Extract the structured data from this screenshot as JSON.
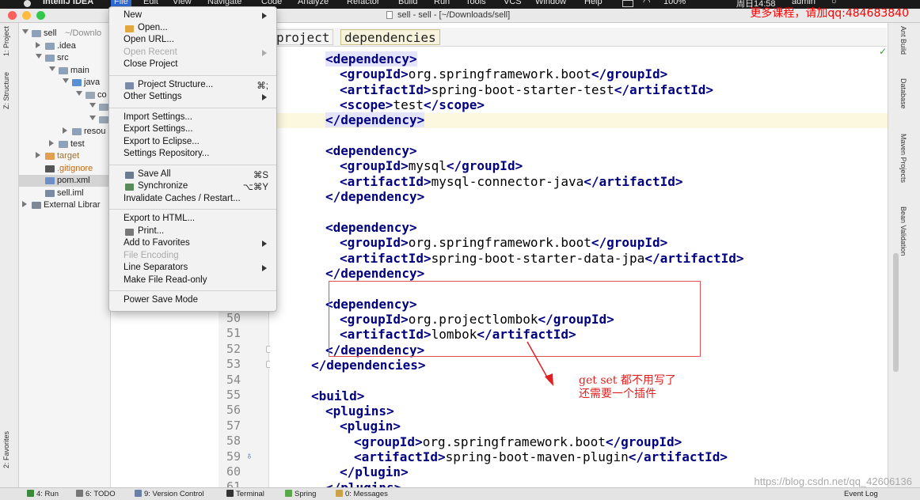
{
  "menubar": {
    "app_name": "IntelliJ IDEA",
    "items": [
      "File",
      "Edit",
      "View",
      "Navigate",
      "Code",
      "Analyze",
      "Refactor",
      "Build",
      "Run",
      "Tools",
      "VCS",
      "Window",
      "Help"
    ],
    "battery": "100%",
    "clock": "周日14:58",
    "user": "admin"
  },
  "titlebar": {
    "title": "sell - sell - [~/Downloads/sell]",
    "promo": "更多课程，请加qq:484683840",
    "traffic_colors": [
      "#fc605c",
      "#fdbc40",
      "#34c84a"
    ]
  },
  "left_strip": {
    "tabs": [
      "1: Project",
      "Z: Structure",
      "2: Favorites"
    ]
  },
  "project_tree": {
    "rows": [
      {
        "label": "sell",
        "suffix": "~/Downlo",
        "arrow": "down",
        "icon": "folder-icon"
      },
      {
        "label": ".idea",
        "arrow": "right",
        "icon": "folder-icon"
      },
      {
        "label": "src",
        "arrow": "down",
        "icon": "folder-icon"
      },
      {
        "label": "main",
        "arrow": "down",
        "icon": "folder-icon"
      },
      {
        "label": "java",
        "arrow": "down",
        "icon": "source-folder-icon"
      },
      {
        "label": "co",
        "arrow": "down",
        "icon": "package-icon"
      },
      {
        "label": "",
        "arrow": "down",
        "icon": "package-icon"
      },
      {
        "label": "",
        "arrow": "down",
        "icon": "package-icon"
      },
      {
        "label": "resou",
        "arrow": "right",
        "icon": "folder-icon"
      },
      {
        "label": "test",
        "arrow": "right",
        "icon": "folder-icon"
      },
      {
        "label": "target",
        "arrow": "right",
        "icon": "excluded-folder-icon"
      },
      {
        "label": ".gitignore",
        "arrow": "",
        "icon": "git-file-icon"
      },
      {
        "label": "pom.xml",
        "arrow": "",
        "icon": "maven-file-icon"
      },
      {
        "label": "sell.iml",
        "arrow": "",
        "icon": "module-file-icon"
      },
      {
        "label": "External Librar",
        "arrow": "right",
        "icon": "library-icon"
      }
    ]
  },
  "file_menu": {
    "items": [
      {
        "label": "New",
        "submenu": true
      },
      {
        "label": "Open...",
        "icon": "folder-open-icon"
      },
      {
        "label": "Open URL..."
      },
      {
        "label": "Open Recent",
        "submenu": true,
        "disabled": true
      },
      {
        "label": "Close Project"
      },
      {
        "sep": true
      },
      {
        "label": "Project Structure...",
        "shortcut": "⌘;",
        "icon": "project-structure-icon"
      },
      {
        "label": "Other Settings",
        "submenu": true
      },
      {
        "sep": true
      },
      {
        "label": "Import Settings..."
      },
      {
        "label": "Export Settings..."
      },
      {
        "label": "Export to Eclipse..."
      },
      {
        "label": "Settings Repository..."
      },
      {
        "sep": true
      },
      {
        "label": "Save All",
        "shortcut": "⌘S",
        "icon": "save-all-icon"
      },
      {
        "label": "Synchronize",
        "shortcut": "⌥⌘Y",
        "icon": "synchronize-icon"
      },
      {
        "label": "Invalidate Caches / Restart..."
      },
      {
        "sep": true
      },
      {
        "label": "Export to HTML..."
      },
      {
        "label": "Print...",
        "icon": "print-icon"
      },
      {
        "label": "Add to Favorites",
        "submenu": true
      },
      {
        "label": "File Encoding",
        "disabled": true
      },
      {
        "label": "Line Separators",
        "submenu": true
      },
      {
        "label": "Make File Read-only"
      },
      {
        "sep": true
      },
      {
        "label": "Power Save Mode"
      }
    ]
  },
  "breadcrumbs": [
    "project",
    "dependencies"
  ],
  "gutter": {
    "line_numbers": [
      "50",
      "51",
      "52",
      "53",
      "54",
      "55",
      "56",
      "57",
      "58",
      "59",
      "60",
      "61"
    ]
  },
  "code": {
    "lines": [
      {
        "indent": 2,
        "parts": [
          [
            "hl-tag",
            "<dependency>"
          ]
        ]
      },
      {
        "indent": 4,
        "parts": [
          [
            "tag",
            "<groupId>"
          ],
          [
            "txt",
            "org.springframework.boot"
          ],
          [
            "tag",
            "</groupId>"
          ]
        ]
      },
      {
        "indent": 4,
        "parts": [
          [
            "tag",
            "<artifactId>"
          ],
          [
            "txt",
            "spring-boot-starter-test"
          ],
          [
            "tag",
            "</artifactId>"
          ]
        ]
      },
      {
        "indent": 4,
        "parts": [
          [
            "tag",
            "<scope>"
          ],
          [
            "txt",
            "test"
          ],
          [
            "tag",
            "</scope>"
          ]
        ]
      },
      {
        "indent": 2,
        "parts": [
          [
            "hl-tag",
            "</dependency>"
          ]
        ]
      },
      {
        "indent": 0,
        "parts": []
      },
      {
        "indent": 2,
        "parts": [
          [
            "tag",
            "<dependency>"
          ]
        ]
      },
      {
        "indent": 4,
        "parts": [
          [
            "tag",
            "<groupId>"
          ],
          [
            "txt",
            "mysql"
          ],
          [
            "tag",
            "</groupId>"
          ]
        ]
      },
      {
        "indent": 4,
        "parts": [
          [
            "tag",
            "<artifactId>"
          ],
          [
            "txt",
            "mysql-connector-java"
          ],
          [
            "tag",
            "</artifactId>"
          ]
        ]
      },
      {
        "indent": 2,
        "parts": [
          [
            "tag",
            "</dependency>"
          ]
        ]
      },
      {
        "indent": 0,
        "parts": []
      },
      {
        "indent": 2,
        "parts": [
          [
            "tag",
            "<dependency>"
          ]
        ]
      },
      {
        "indent": 4,
        "parts": [
          [
            "tag",
            "<groupId>"
          ],
          [
            "txt",
            "org.springframework.boot"
          ],
          [
            "tag",
            "</groupId>"
          ]
        ]
      },
      {
        "indent": 4,
        "parts": [
          [
            "tag",
            "<artifactId>"
          ],
          [
            "txt",
            "spring-boot-starter-data-jpa"
          ],
          [
            "tag",
            "</artifactId>"
          ]
        ]
      },
      {
        "indent": 2,
        "parts": [
          [
            "tag",
            "</dependency>"
          ]
        ]
      },
      {
        "indent": 0,
        "parts": []
      },
      {
        "indent": 2,
        "parts": [
          [
            "tag",
            "<dependency>"
          ]
        ]
      },
      {
        "indent": 4,
        "parts": [
          [
            "tag",
            "<groupId>"
          ],
          [
            "txt",
            "org.projectlombok"
          ],
          [
            "tag",
            "</groupId>"
          ]
        ]
      },
      {
        "indent": 4,
        "parts": [
          [
            "tag",
            "<artifactId>"
          ],
          [
            "txt",
            "lombok"
          ],
          [
            "tag",
            "</artifactId>"
          ]
        ]
      },
      {
        "indent": 2,
        "parts": [
          [
            "tag",
            "</dependency>"
          ]
        ]
      },
      {
        "indent": 0,
        "parts": [
          [
            "tag",
            "</dependencies>"
          ]
        ]
      },
      {
        "indent": 0,
        "parts": []
      },
      {
        "indent": 0,
        "parts": [
          [
            "tag",
            "<build>"
          ]
        ]
      },
      {
        "indent": 2,
        "parts": [
          [
            "tag",
            "<plugins>"
          ]
        ]
      },
      {
        "indent": 4,
        "parts": [
          [
            "tag",
            "<plugin>"
          ]
        ]
      },
      {
        "indent": 6,
        "parts": [
          [
            "tag",
            "<groupId>"
          ],
          [
            "txt",
            "org.springframework.boot"
          ],
          [
            "tag",
            "</groupId>"
          ]
        ]
      },
      {
        "indent": 6,
        "parts": [
          [
            "tag",
            "<artifactId>"
          ],
          [
            "txt",
            "spring-boot-maven-plugin"
          ],
          [
            "tag",
            "</artifactId>"
          ]
        ]
      },
      {
        "indent": 4,
        "parts": [
          [
            "tag",
            "</plugin>"
          ]
        ]
      },
      {
        "indent": 2,
        "parts": [
          [
            "tag",
            "</plugins>"
          ]
        ]
      }
    ]
  },
  "annotation": {
    "line1": "get  set 都不用写了",
    "line2": "还需要一个插件"
  },
  "right_strip": {
    "tabs": [
      "Ant Build",
      "Database",
      "Maven Projects",
      "Bean Validation"
    ]
  },
  "bottom_bar": {
    "tabs": [
      {
        "label": "4: Run",
        "icon": "run-icon",
        "color": "#3a8a3a"
      },
      {
        "label": "6: TODO",
        "icon": "todo-icon",
        "color": "#777777"
      },
      {
        "label": "9: Version Control",
        "icon": "vcs-icon",
        "color": "#6a7fa8"
      },
      {
        "label": "Terminal",
        "icon": "terminal-icon",
        "color": "#333333"
      },
      {
        "label": "Spring",
        "icon": "spring-icon",
        "color": "#5aa84a"
      },
      {
        "label": "0: Messages",
        "icon": "messages-icon",
        "color": "#c9a24a"
      }
    ],
    "event_log": "Event Log"
  },
  "url_watermark": "https://blog.csdn.net/qq_42606136"
}
